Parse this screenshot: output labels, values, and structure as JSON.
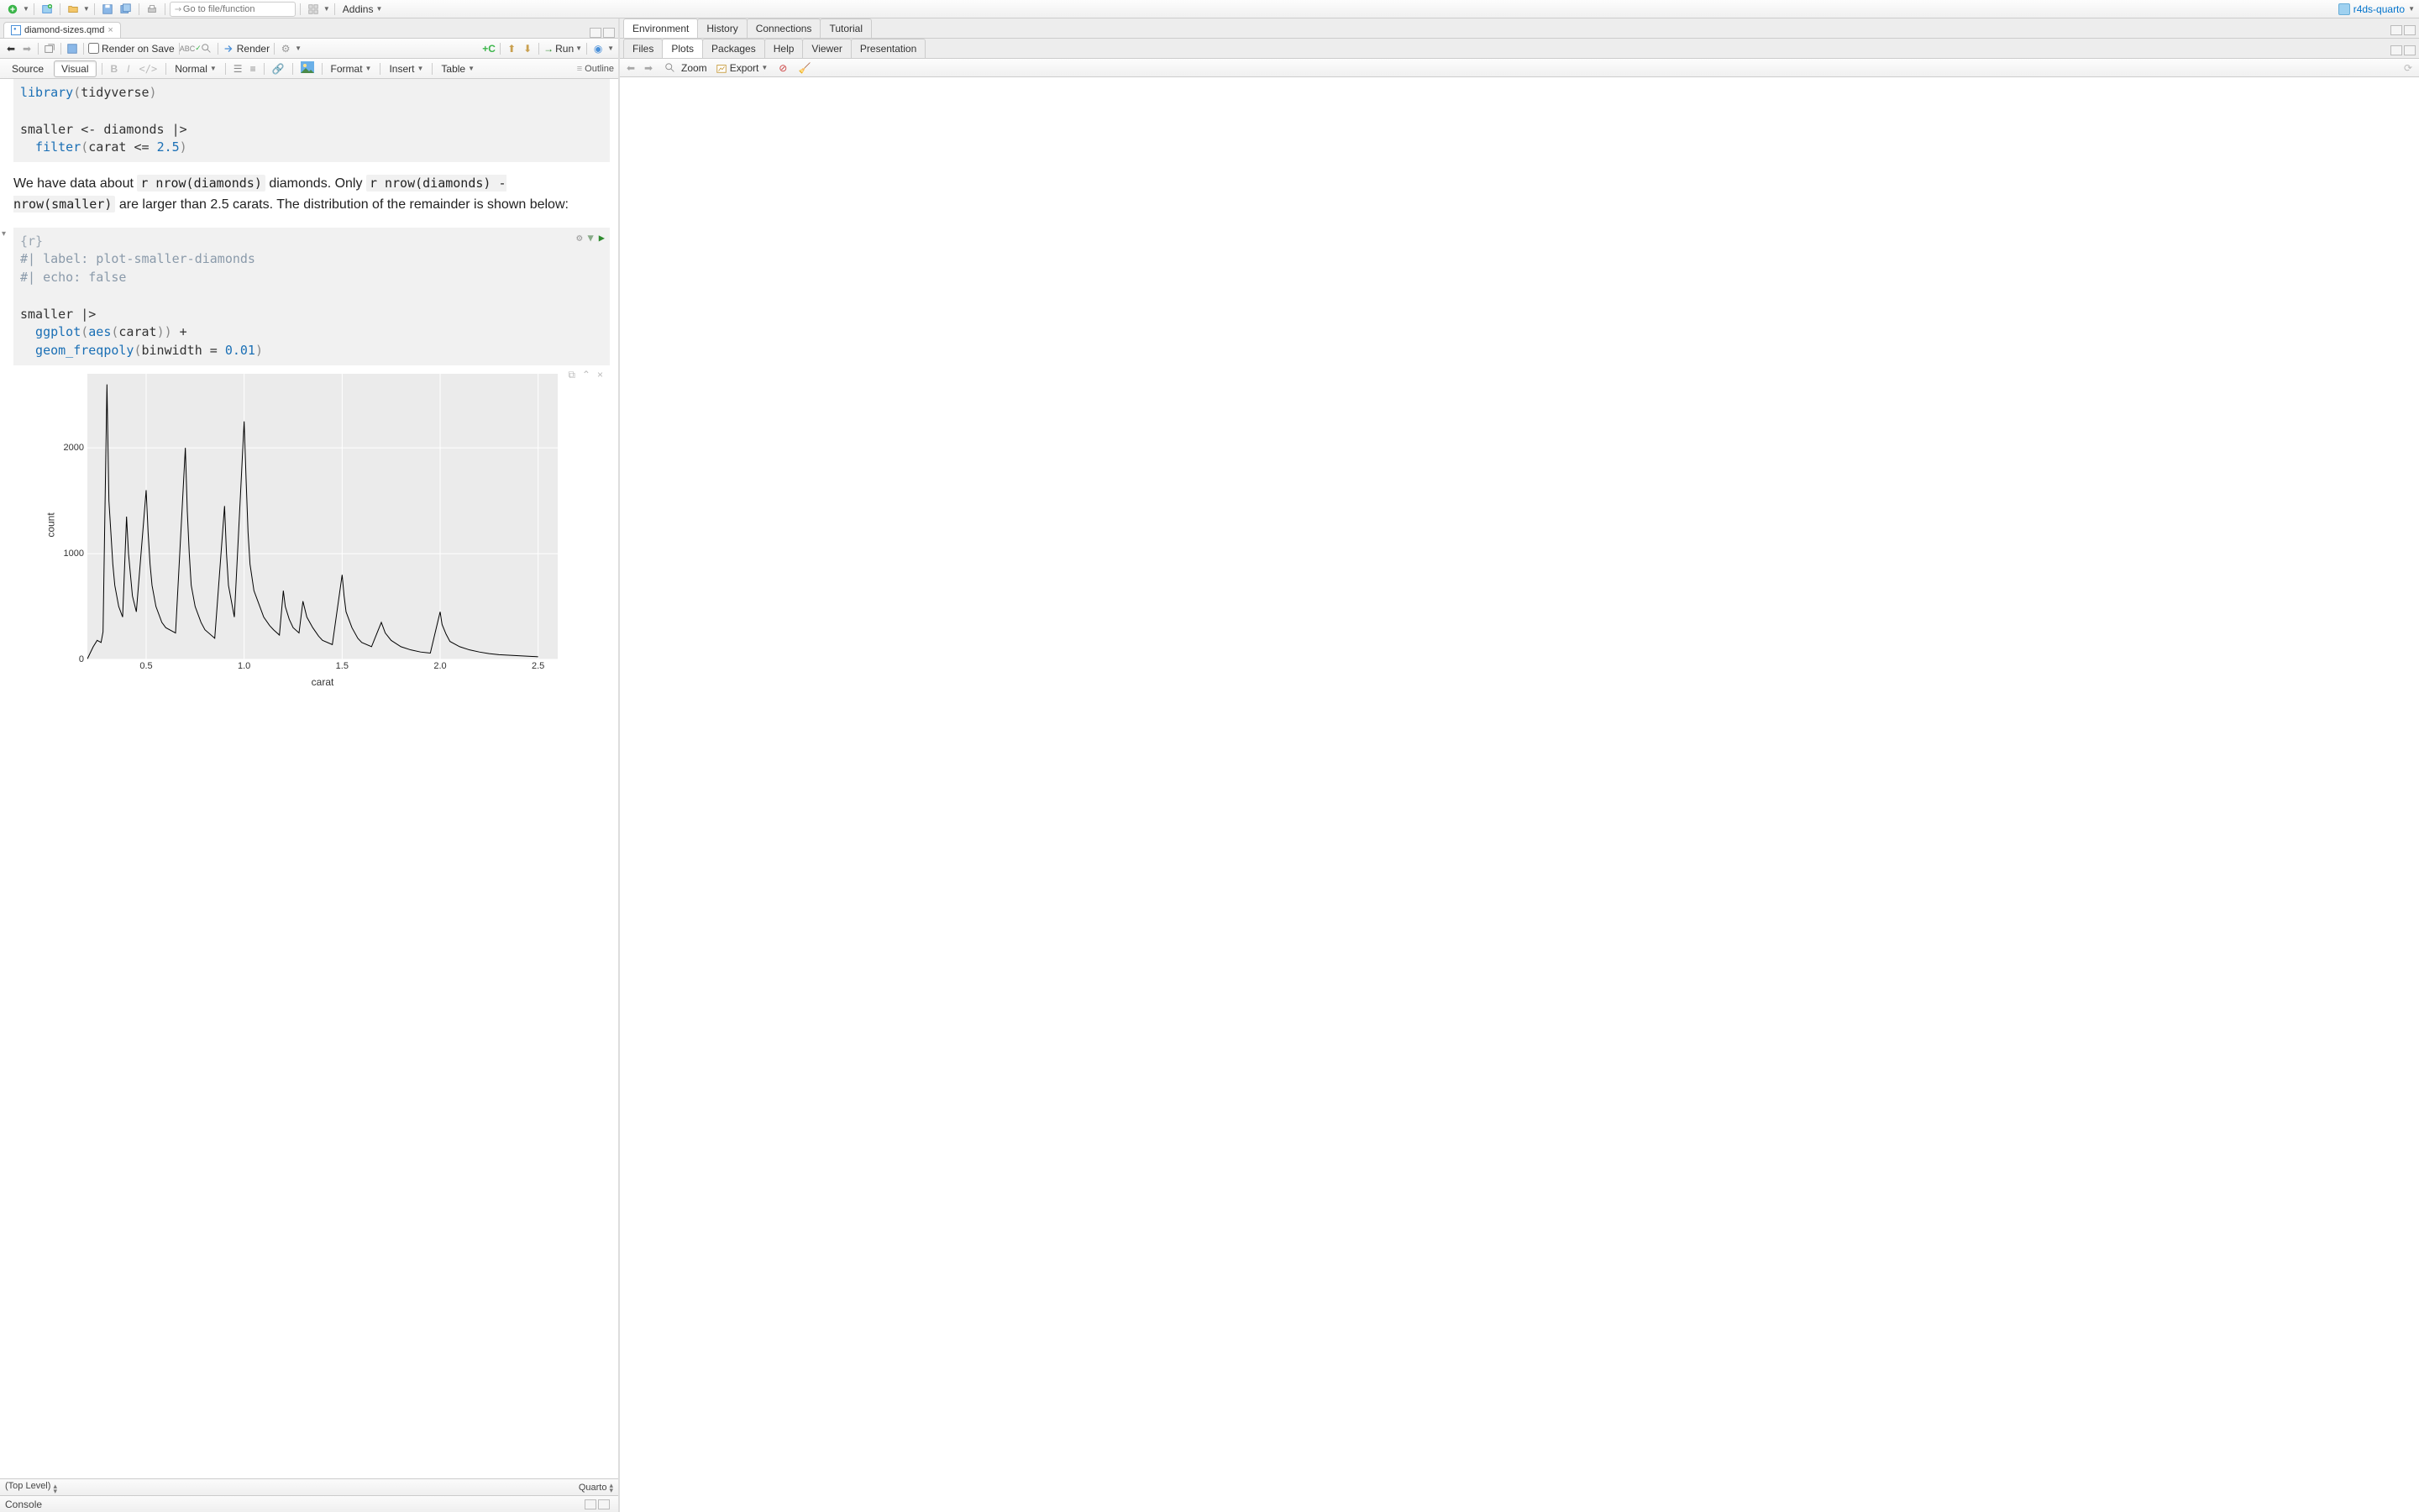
{
  "project_name": "r4ds-quarto",
  "goto_placeholder": "Go to file/function",
  "addins_label": "Addins",
  "file_tab": "diamond-sizes.qmd",
  "render_on_save": "Render on Save",
  "render_label": "Render",
  "run_label": "Run",
  "outline_label": "Outline",
  "mode_source": "Source",
  "mode_visual": "Visual",
  "style_normal": "Normal",
  "menu_format": "Format",
  "menu_insert": "Insert",
  "menu_table": "Table",
  "code1": {
    "l1a": "library",
    "l1b": "(",
    "l1c": "tidyverse",
    "l1d": ")",
    "l2": "smaller <- diamonds |>",
    "l3a": "  filter",
    "l3b": "(",
    "l3c": "carat <= ",
    "l3d": "2.5",
    "l3e": ")"
  },
  "prose": {
    "p1": "We have data about ",
    "p2": "r nrow(diamonds)",
    "p3": " diamonds. Only ",
    "p4": "r nrow(diamonds) - nrow(smaller)",
    "p5": " are larger than 2.5 carats. The distribution of the remainder is shown below:"
  },
  "code2": {
    "hdr": "{r}",
    "l1": "#| label: plot-smaller-diamonds",
    "l2": "#| echo: false",
    "l3": "smaller |>",
    "l4a": "  ggplot",
    "l4b": "(",
    "l4c": "aes",
    "l4d": "(",
    "l4e": "carat",
    "l4f": "))",
    "l4g": " + ",
    "l5a": "  geom_freqpoly",
    "l5b": "(",
    "l5c": "binwidth = ",
    "l5d": "0.01",
    "l5e": ")"
  },
  "status_left": "(Top Level)",
  "status_right": "Quarto",
  "console_label": "Console",
  "right_pane": {
    "env_tabs": [
      "Environment",
      "History",
      "Connections",
      "Tutorial"
    ],
    "plot_tabs": [
      "Files",
      "Plots",
      "Packages",
      "Help",
      "Viewer",
      "Presentation"
    ],
    "active_env": 0,
    "active_plot": 1,
    "zoom": "Zoom",
    "export": "Export"
  },
  "chart_data": {
    "type": "line",
    "xlabel": "carat",
    "ylabel": "count",
    "xlim": [
      0.2,
      2.6
    ],
    "ylim": [
      0,
      2700
    ],
    "xticks": [
      0.5,
      1.0,
      1.5,
      2.0,
      2.5
    ],
    "yticks": [
      0,
      1000,
      2000
    ],
    "title": "",
    "series": [
      {
        "name": "count",
        "x_y": [
          [
            0.2,
            5
          ],
          [
            0.23,
            120
          ],
          [
            0.25,
            180
          ],
          [
            0.27,
            160
          ],
          [
            0.28,
            260
          ],
          [
            0.3,
            2600
          ],
          [
            0.31,
            1500
          ],
          [
            0.32,
            1200
          ],
          [
            0.33,
            900
          ],
          [
            0.34,
            700
          ],
          [
            0.35,
            600
          ],
          [
            0.36,
            500
          ],
          [
            0.38,
            400
          ],
          [
            0.4,
            1350
          ],
          [
            0.41,
            1000
          ],
          [
            0.42,
            800
          ],
          [
            0.43,
            600
          ],
          [
            0.45,
            450
          ],
          [
            0.5,
            1600
          ],
          [
            0.51,
            1200
          ],
          [
            0.52,
            900
          ],
          [
            0.53,
            700
          ],
          [
            0.55,
            500
          ],
          [
            0.58,
            350
          ],
          [
            0.6,
            300
          ],
          [
            0.65,
            250
          ],
          [
            0.7,
            2000
          ],
          [
            0.71,
            1400
          ],
          [
            0.72,
            1000
          ],
          [
            0.73,
            700
          ],
          [
            0.75,
            500
          ],
          [
            0.78,
            350
          ],
          [
            0.8,
            280
          ],
          [
            0.85,
            200
          ],
          [
            0.9,
            1450
          ],
          [
            0.91,
            1000
          ],
          [
            0.92,
            700
          ],
          [
            0.95,
            400
          ],
          [
            1.0,
            2250
          ],
          [
            1.01,
            1700
          ],
          [
            1.02,
            1200
          ],
          [
            1.03,
            900
          ],
          [
            1.05,
            650
          ],
          [
            1.08,
            500
          ],
          [
            1.1,
            400
          ],
          [
            1.13,
            320
          ],
          [
            1.15,
            280
          ],
          [
            1.18,
            230
          ],
          [
            1.2,
            650
          ],
          [
            1.21,
            500
          ],
          [
            1.23,
            380
          ],
          [
            1.25,
            300
          ],
          [
            1.28,
            250
          ],
          [
            1.3,
            550
          ],
          [
            1.32,
            400
          ],
          [
            1.35,
            300
          ],
          [
            1.38,
            220
          ],
          [
            1.4,
            180
          ],
          [
            1.45,
            140
          ],
          [
            1.5,
            800
          ],
          [
            1.51,
            600
          ],
          [
            1.52,
            450
          ],
          [
            1.55,
            300
          ],
          [
            1.58,
            200
          ],
          [
            1.6,
            160
          ],
          [
            1.65,
            120
          ],
          [
            1.7,
            350
          ],
          [
            1.72,
            250
          ],
          [
            1.75,
            180
          ],
          [
            1.8,
            120
          ],
          [
            1.85,
            90
          ],
          [
            1.9,
            70
          ],
          [
            1.95,
            60
          ],
          [
            2.0,
            450
          ],
          [
            2.01,
            330
          ],
          [
            2.03,
            240
          ],
          [
            2.05,
            170
          ],
          [
            2.1,
            120
          ],
          [
            2.15,
            90
          ],
          [
            2.2,
            70
          ],
          [
            2.25,
            55
          ],
          [
            2.3,
            45
          ],
          [
            2.35,
            40
          ],
          [
            2.4,
            35
          ],
          [
            2.45,
            30
          ],
          [
            2.5,
            25
          ]
        ]
      }
    ]
  }
}
